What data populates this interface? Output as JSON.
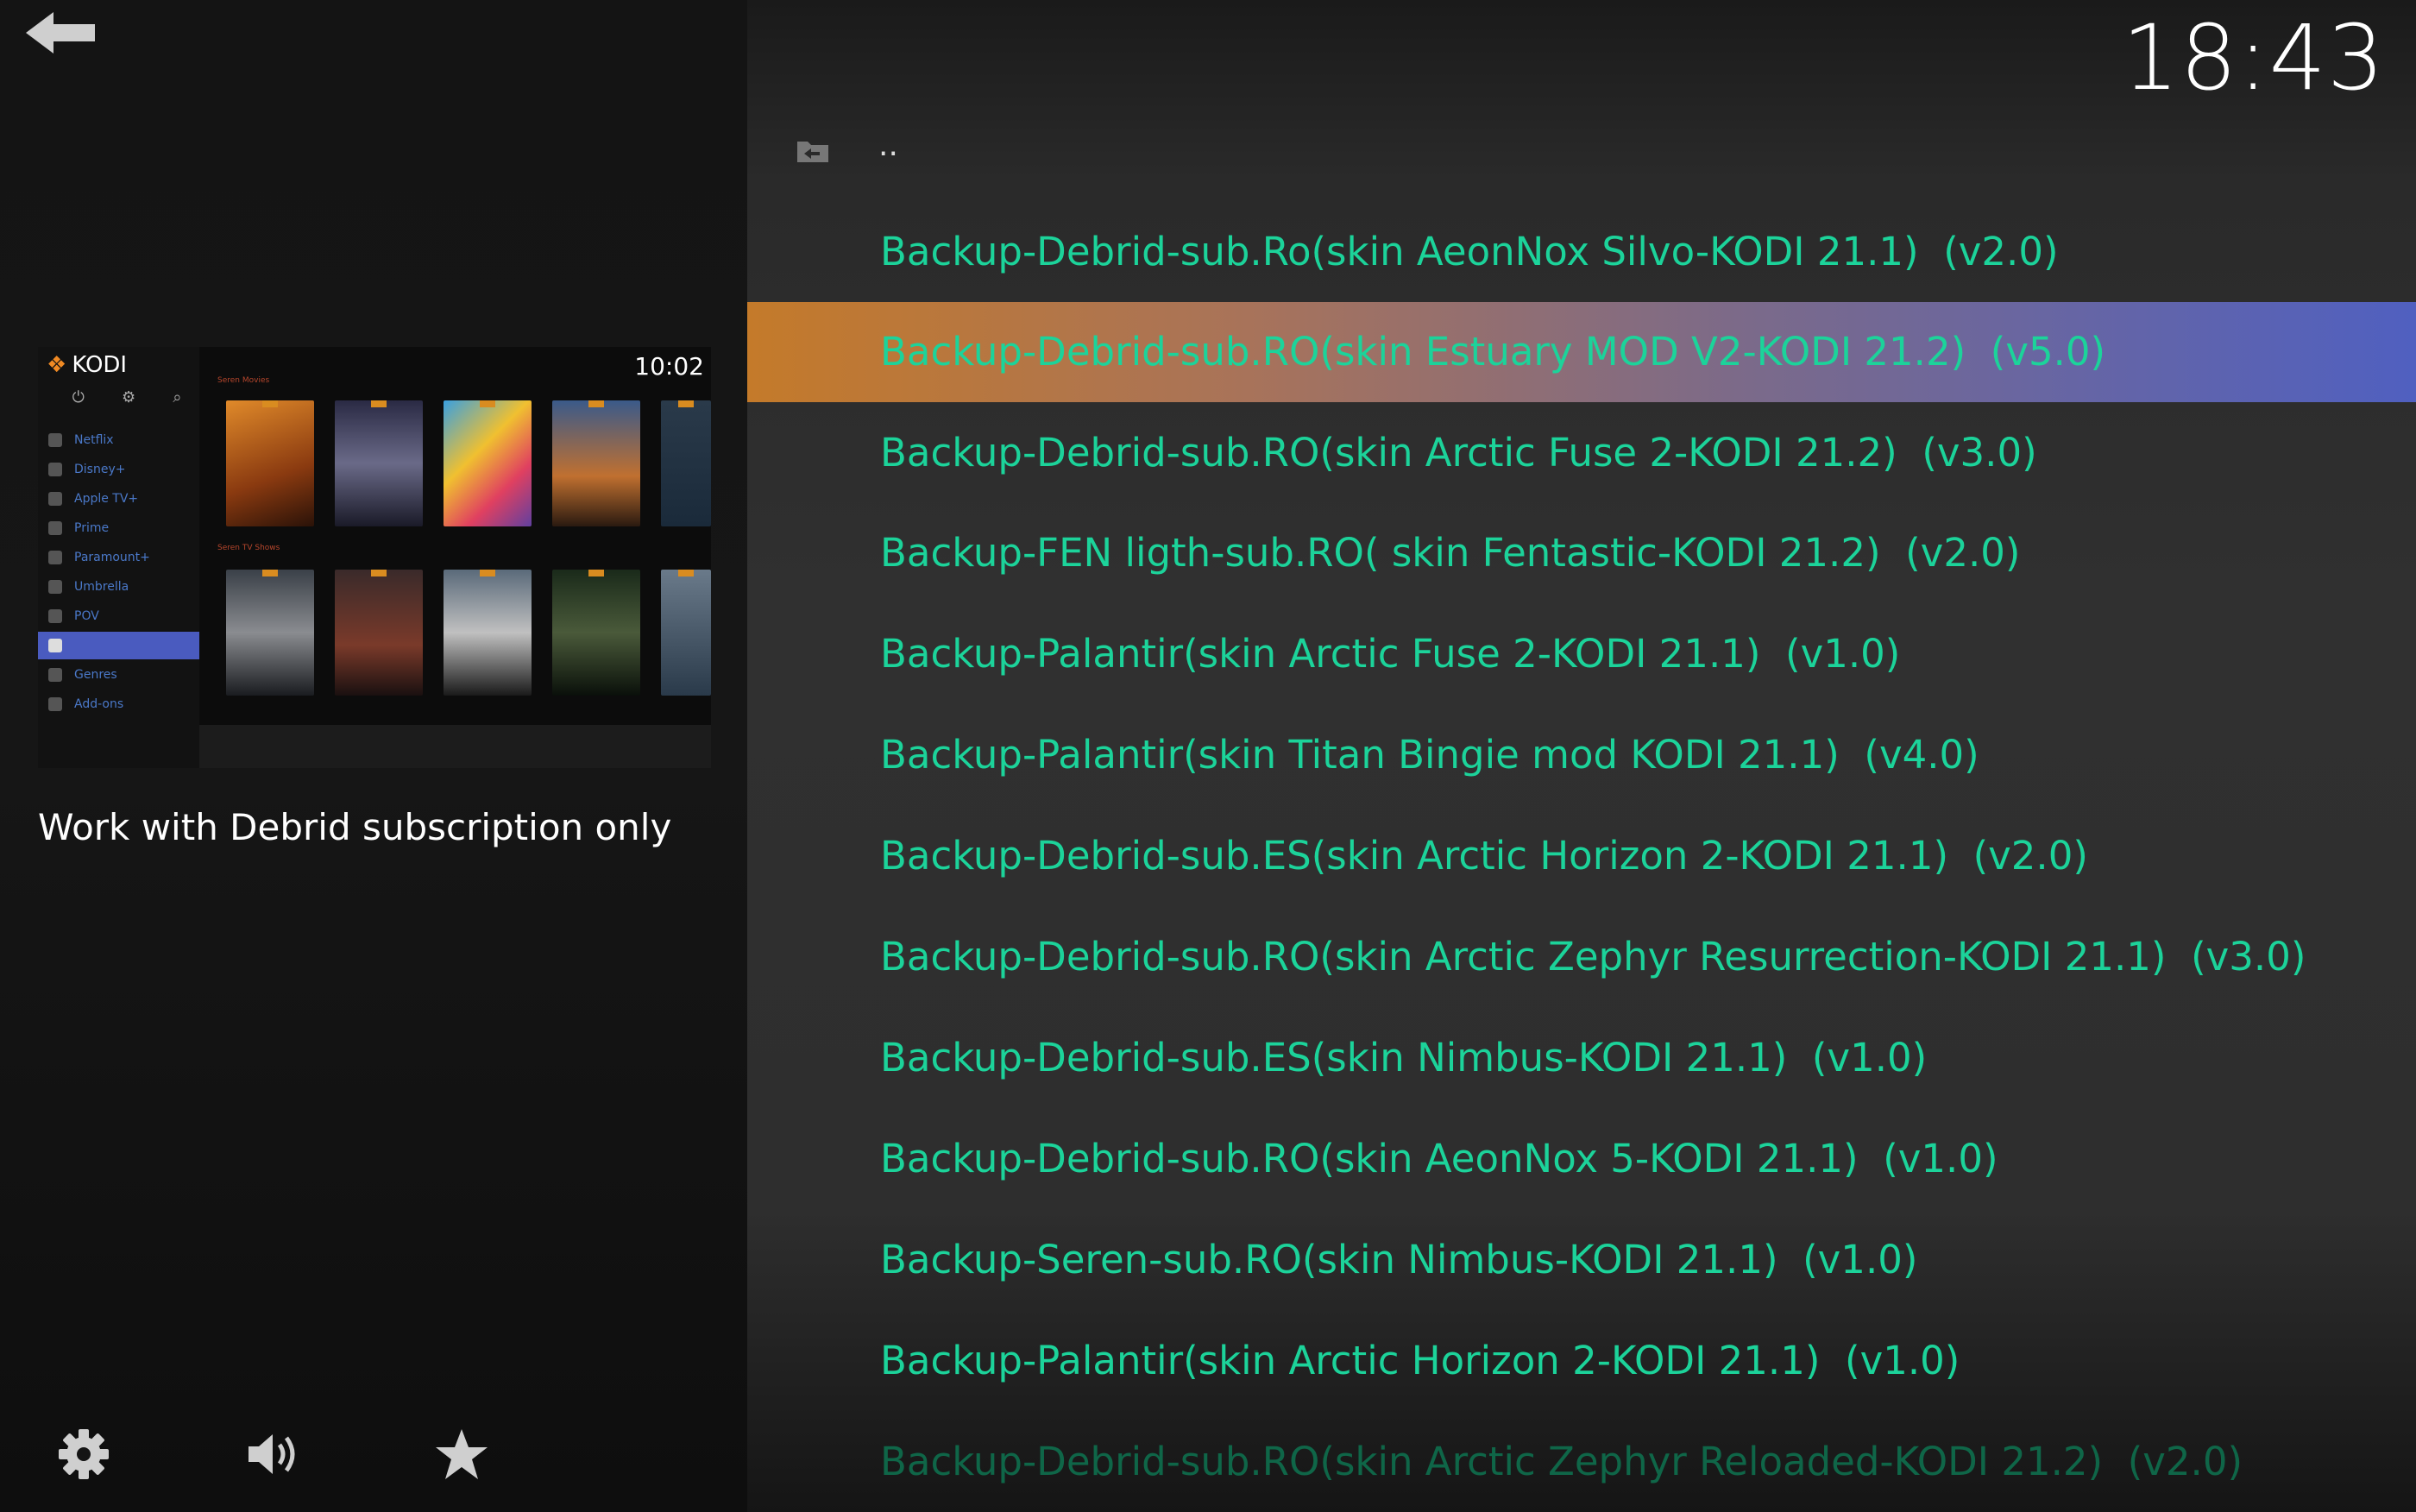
{
  "clock": "18:43",
  "preview": {
    "app_name": "KODI",
    "time": "10:02",
    "sidebar_items": [
      "Netflix",
      "Disney+",
      "Apple TV+",
      "Prime",
      "Paramount+",
      "Umbrella",
      "POV",
      "",
      "Genres",
      "Add-ons"
    ],
    "row1_label": "Seren Movies",
    "row2_label": "Seren TV Shows"
  },
  "description": "Work with  Debrid subscription only",
  "parent_label": "..",
  "list": {
    "selected_index": 1,
    "items": [
      "Backup-Debrid-sub.Ro(skin AeonNox Silvo-KODI 21.1)  (v2.0)",
      "Backup-Debrid-sub.RO(skin Estuary MOD V2-KODI 21.2)  (v5.0)",
      "Backup-Debrid-sub.RO(skin Arctic Fuse 2-KODI 21.2)  (v3.0)",
      "Backup-FEN ligth-sub.RO( skin Fentastic-KODI 21.2)  (v2.0)",
      "Backup-Palantir(skin Arctic Fuse 2-KODI 21.1)  (v1.0)",
      "Backup-Palantir(skin Titan Bingie mod KODI 21.1)  (v4.0)",
      "Backup-Debrid-sub.ES(skin Arctic Horizon 2-KODI 21.1)  (v2.0)",
      "Backup-Debrid-sub.RO(skin Arctic Zephyr Resurrection-KODI 21.1)  (v3.0)",
      "Backup-Debrid-sub.ES(skin Nimbus-KODI 21.1)  (v1.0)",
      "Backup-Debrid-sub.RO(skin AeonNox 5-KODI 21.1)  (v1.0)",
      "Backup-Seren-sub.RO(skin Nimbus-KODI 21.1)  (v1.0)",
      "Backup-Palantir(skin Arctic Horizon 2-KODI 21.1)  (v1.0)",
      "Backup-Debrid-sub.RO(skin Arctic Zephyr Reloaded-KODI 21.2)  (v2.0)"
    ]
  },
  "icons": {
    "back": "back-arrow-icon",
    "settings": "gear-icon",
    "volume": "volume-icon",
    "favourites": "star-icon",
    "parent_folder": "folder-back-icon"
  },
  "colors": {
    "item_text": "#1cd39a",
    "highlight_start": "#c47a2a",
    "highlight_end": "#5060c0"
  }
}
